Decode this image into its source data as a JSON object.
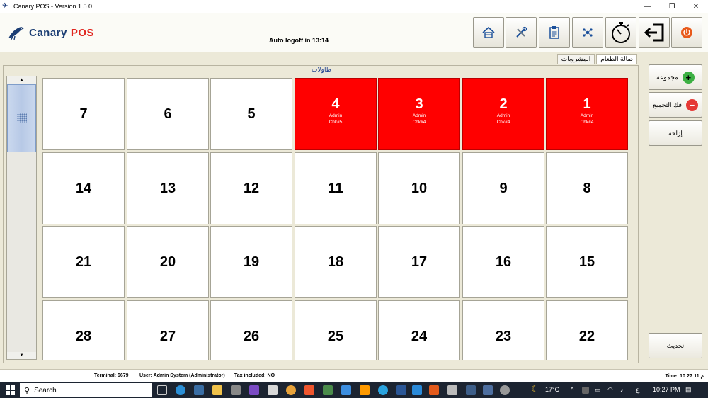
{
  "window": {
    "title": "Canary POS - Version 1.5.0",
    "minimize_glyph": "—",
    "restore_glyph": "❐",
    "close_glyph": "✕"
  },
  "logo": {
    "part1": "Canary",
    "part2": "POS"
  },
  "header": {
    "autologoff": "Auto logoff in 13:14"
  },
  "toolbar": [
    "home-icon",
    "tools-icon",
    "clipboard-icon",
    "network-icon",
    "stopwatch-icon",
    "exit-icon",
    "power-icon"
  ],
  "tabs": [
    {
      "label": "المشروبات",
      "active": false
    },
    {
      "label": "صالة الطعام",
      "active": true
    }
  ],
  "panel_title": "طاولات",
  "tables": [
    {
      "num": "7"
    },
    {
      "num": "6"
    },
    {
      "num": "5"
    },
    {
      "num": "4",
      "busy": true,
      "user": "Admin",
      "check": "Chk#5"
    },
    {
      "num": "3",
      "busy": true,
      "user": "Admin",
      "check": "Chk#4"
    },
    {
      "num": "2",
      "busy": true,
      "user": "Admin",
      "check": "Chk#4"
    },
    {
      "num": "1",
      "busy": true,
      "user": "Admin",
      "check": "Chk#4"
    },
    {
      "num": "14"
    },
    {
      "num": "13"
    },
    {
      "num": "12"
    },
    {
      "num": "11"
    },
    {
      "num": "10"
    },
    {
      "num": "9"
    },
    {
      "num": "8"
    },
    {
      "num": "21"
    },
    {
      "num": "20"
    },
    {
      "num": "19"
    },
    {
      "num": "18"
    },
    {
      "num": "17"
    },
    {
      "num": "16"
    },
    {
      "num": "15"
    },
    {
      "num": "28"
    },
    {
      "num": "27"
    },
    {
      "num": "26"
    },
    {
      "num": "25"
    },
    {
      "num": "24"
    },
    {
      "num": "23"
    },
    {
      "num": "22"
    }
  ],
  "side_buttons": {
    "group": "مجموعة",
    "ungroup": "فك التجميع",
    "move": "إزاحة",
    "refresh": "تحديث"
  },
  "colors": {
    "busy": "#ff0000",
    "group_icon": "#3cb043",
    "ungroup_icon": "#e53935",
    "power": "#e8591a"
  },
  "status": {
    "terminal": "Terminal: 6679",
    "user": "User: Admin System (Administrator)",
    "tax": "Tax included: NO",
    "time": "Time: 10:27:11 م"
  },
  "taskbar": {
    "search_placeholder": "Search",
    "weather": "17°C",
    "lang": "ع",
    "clock": "10:27 PM"
  }
}
